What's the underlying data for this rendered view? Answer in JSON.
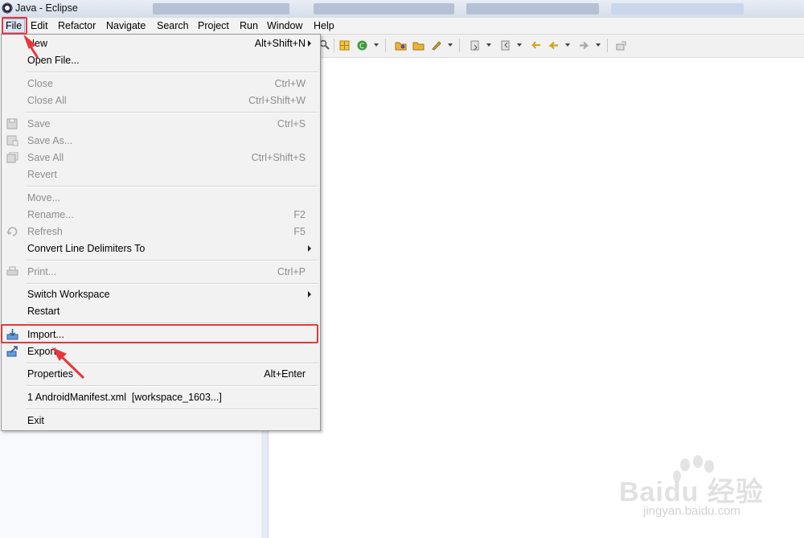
{
  "window": {
    "title": "Java - Eclipse"
  },
  "menubar": {
    "items": [
      "File",
      "Edit",
      "Refactor",
      "Navigate",
      "Search",
      "Project",
      "Run",
      "Window",
      "Help"
    ],
    "active": "File"
  },
  "file_menu": {
    "items": [
      {
        "label": "New",
        "shortcut": "Alt+Shift+N",
        "submenu": true,
        "enabled": true
      },
      {
        "label": "Open File...",
        "shortcut": "",
        "enabled": true
      },
      {
        "label": "Close",
        "shortcut": "Ctrl+W",
        "enabled": false
      },
      {
        "label": "Close All",
        "shortcut": "Ctrl+Shift+W",
        "enabled": false
      },
      {
        "label": "Save",
        "shortcut": "Ctrl+S",
        "enabled": false,
        "icon": "save-icon"
      },
      {
        "label": "Save As...",
        "shortcut": "",
        "enabled": false,
        "icon": "save-as-icon"
      },
      {
        "label": "Save All",
        "shortcut": "Ctrl+Shift+S",
        "enabled": false,
        "icon": "save-all-icon"
      },
      {
        "label": "Revert",
        "shortcut": "",
        "enabled": false
      },
      {
        "label": "Move...",
        "shortcut": "",
        "enabled": false
      },
      {
        "label": "Rename...",
        "shortcut": "F2",
        "enabled": false
      },
      {
        "label": "Refresh",
        "shortcut": "F5",
        "enabled": false,
        "icon": "refresh-icon"
      },
      {
        "label": "Convert Line Delimiters To",
        "shortcut": "",
        "submenu": true,
        "enabled": true
      },
      {
        "label": "Print...",
        "shortcut": "Ctrl+P",
        "enabled": false,
        "icon": "print-icon"
      },
      {
        "label": "Switch Workspace",
        "shortcut": "",
        "submenu": true,
        "enabled": true
      },
      {
        "label": "Restart",
        "shortcut": "",
        "enabled": true
      },
      {
        "label": "Import...",
        "shortcut": "",
        "enabled": true,
        "icon": "import-icon",
        "highlighted": true
      },
      {
        "label": "Export...",
        "shortcut": "",
        "enabled": true,
        "icon": "export-icon"
      },
      {
        "label": "Properties",
        "shortcut": "Alt+Enter",
        "enabled": true
      },
      {
        "label": "1 AndroidManifest.xml  [workspace_1603...]",
        "shortcut": "",
        "enabled": true
      },
      {
        "label": "Exit",
        "shortcut": "",
        "enabled": true
      }
    ]
  },
  "watermark": {
    "brand": "Baidu 经验",
    "url": "jingyan.baidu.com"
  },
  "colors": {
    "highlight": "#e8373a",
    "menu_bg": "#f2f2f2",
    "disabled_text": "#8d8d8d"
  }
}
